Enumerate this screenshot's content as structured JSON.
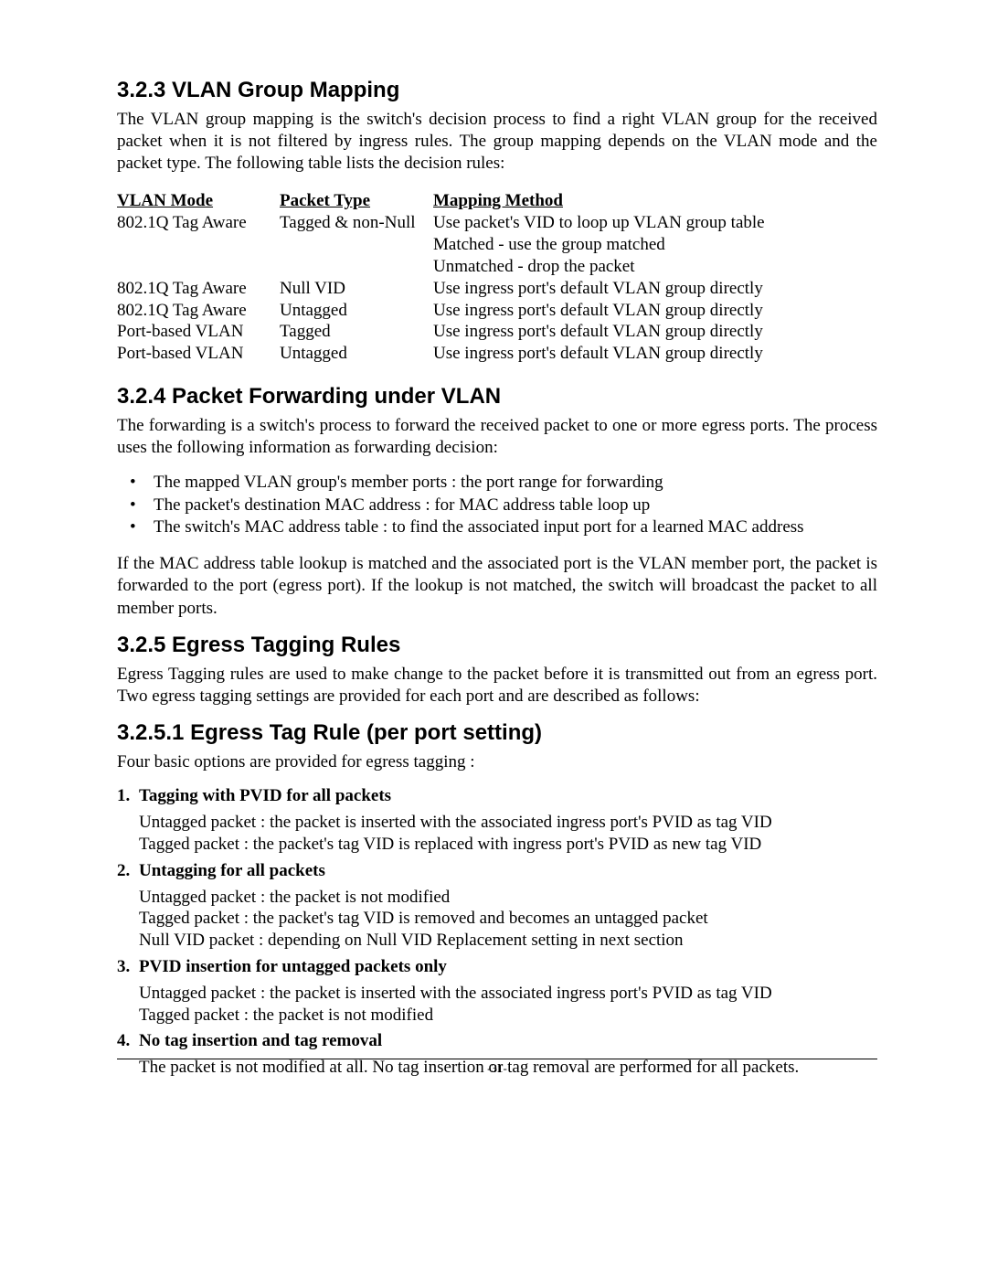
{
  "s323": {
    "heading": "3.2.3 VLAN Group Mapping",
    "para": "The VLAN group mapping is the switch's decision process to find a right VLAN group for the received packet when it is not filtered by ingress rules. The group mapping depends on the VLAN mode and the packet type. The following table lists the decision rules:",
    "table": {
      "headers": [
        "VLAN Mode",
        "Packet Type",
        "Mapping Method"
      ],
      "rows": [
        [
          "802.1Q Tag Aware",
          "Tagged & non-Null",
          "Use packet's VID to loop up VLAN group table"
        ],
        [
          "",
          "",
          "Matched - use the group matched"
        ],
        [
          "",
          "",
          "Unmatched - drop the packet"
        ],
        [
          "802.1Q Tag Aware",
          "Null VID",
          "Use ingress port's default VLAN group directly"
        ],
        [
          "802.1Q Tag Aware",
          "Untagged",
          "Use ingress port's default VLAN group directly"
        ],
        [
          "Port-based VLAN",
          "Tagged",
          "Use ingress port's default VLAN group directly"
        ],
        [
          "Port-based VLAN",
          "Untagged",
          "Use ingress port's default VLAN group directly"
        ]
      ]
    }
  },
  "s324": {
    "heading": "3.2.4 Packet Forwarding under VLAN",
    "para1": "The forwarding is a switch's process to forward the received packet to one or more egress ports. The process uses the following information as forwarding decision:",
    "bullets": [
      "The mapped VLAN group's member ports : the port range for forwarding",
      "The packet's destination MAC address : for MAC address table loop up",
      "The switch's MAC address table : to find the associated input port for a learned MAC address"
    ],
    "para2": "If the MAC address table lookup is matched and the associated port is the VLAN member port, the packet is forwarded to the port (egress port). If the lookup is not matched, the switch will broadcast the packet to all member ports."
  },
  "s325": {
    "heading": "3.2.5 Egress Tagging Rules",
    "para": "Egress Tagging rules are used to make change to the packet before it is transmitted out from an egress port. Two egress tagging settings are provided for each port and are described as follows:"
  },
  "s3251": {
    "heading": "3.2.5.1 Egress Tag Rule (per port setting)",
    "para": "Four basic options are provided for egress tagging :",
    "options": [
      {
        "title": "Tagging with PVID for all packets",
        "lines": [
          "Untagged packet : the packet is inserted with the associated ingress port's PVID as tag VID",
          "Tagged packet : the packet's tag VID is replaced with ingress port's PVID as new tag VID"
        ]
      },
      {
        "title": "Untagging for all packets",
        "lines": [
          "Untagged packet : the packet is not modified",
          "Tagged packet : the packet's tag VID is removed and becomes an untagged packet",
          "Null VID packet : depending on Null VID Replacement setting in next section"
        ]
      },
      {
        "title": "PVID insertion for untagged packets only",
        "lines": [
          "Untagged packet : the packet is inserted with the associated ingress port's PVID as tag VID",
          "Tagged packet : the packet is not modified"
        ]
      },
      {
        "title": "No tag insertion and tag removal",
        "lines": [
          "The packet is not modified at all. No tag insertion or tag removal are performed for all packets."
        ]
      }
    ]
  },
  "page_number": "-31-"
}
